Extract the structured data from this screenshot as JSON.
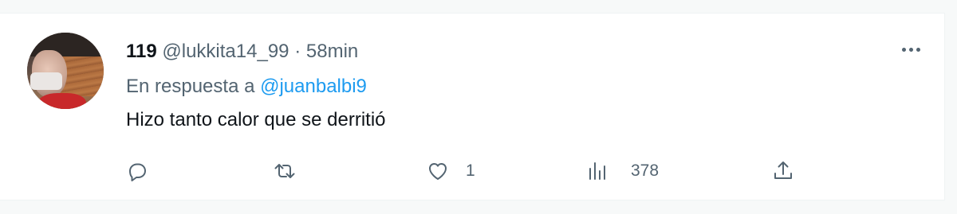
{
  "tweet": {
    "display_name": "119",
    "handle": "@lukkita14_99",
    "separator": "·",
    "time": "58min",
    "reply_prefix": "En respuesta a",
    "reply_to": "@juanbalbi9",
    "text": "Hizo tanto calor que se derritió"
  },
  "actions": {
    "reply_icon": "reply-icon",
    "retweet_icon": "retweet-icon",
    "like_icon": "heart-icon",
    "like_count": "1",
    "views_icon": "views-icon",
    "views_count": "378",
    "share_icon": "share-icon"
  },
  "colors": {
    "link": "#1d9bf0",
    "text": "#0f1419",
    "secondary": "#536471"
  }
}
